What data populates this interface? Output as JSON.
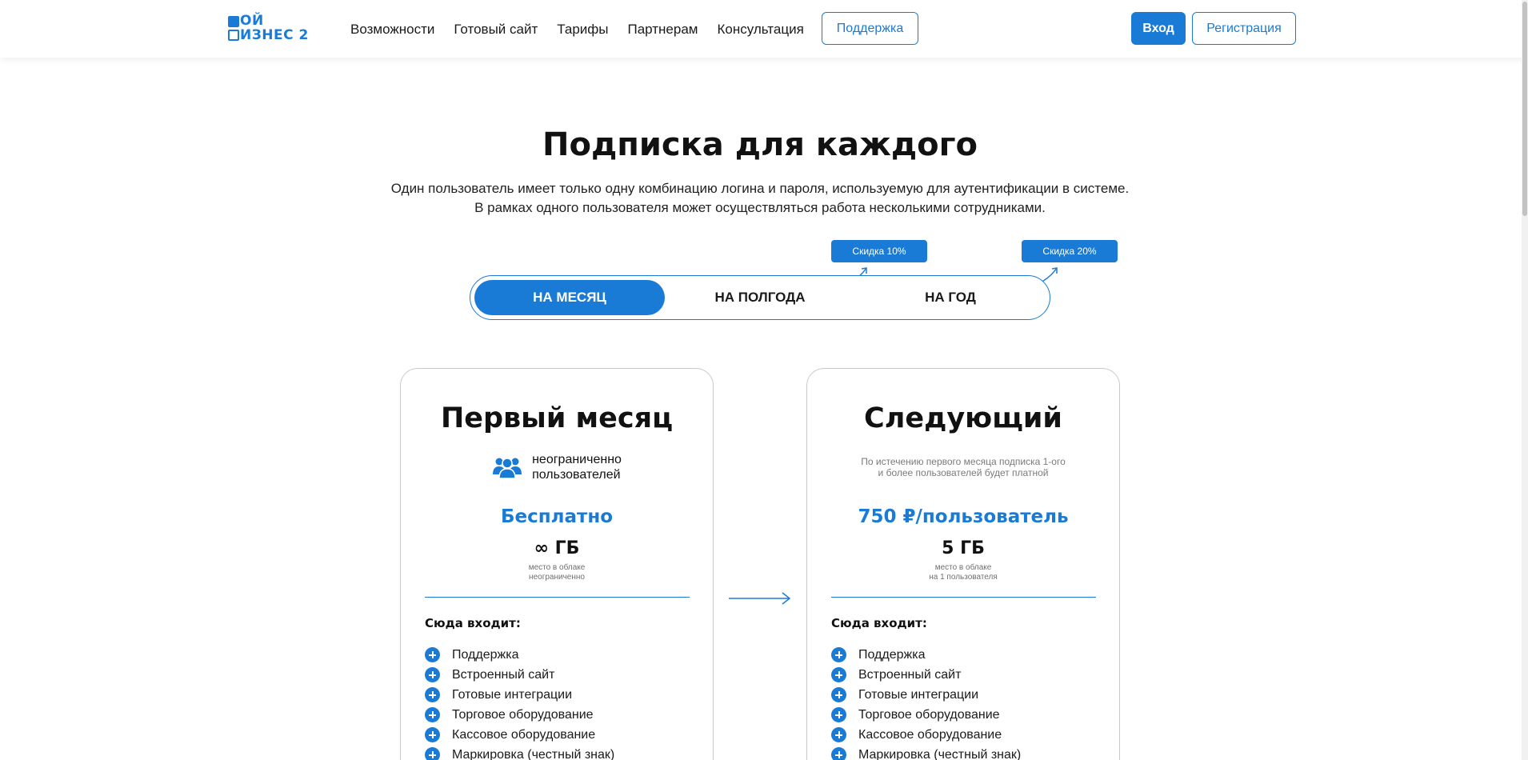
{
  "logo": {
    "line1": "ОЙ",
    "line2": "ИЗНЕС 2"
  },
  "nav": {
    "items": [
      "Возможности",
      "Готовый сайт",
      "Тарифы",
      "Партнерам",
      "Консультация"
    ],
    "support": "Поддержка",
    "login": "Вход",
    "register": "Регистрация"
  },
  "hero": {
    "title": "Подписка для каждого",
    "line1": "Один пользователь имеет только одну комбинацию логина и пароля, используемую для аутентификации в системе.",
    "line2": "В рамках одного пользователя может осуществляться работа несколькими сотрудниками."
  },
  "discounts": {
    "half_year": "Скидка 10%",
    "year": "Скидка 20%"
  },
  "period_toggle": {
    "options": [
      "НА МЕСЯЦ",
      "НА ПОЛГОДА",
      "НА ГОД"
    ],
    "selected": "НА МЕСЯЦ"
  },
  "cards": [
    {
      "title": "Первый месяц",
      "users_line1": "неограниченно",
      "users_line2": "пользователей",
      "price": "Бесплатно",
      "storage": "∞ ГБ",
      "storage_note1": "место в облаке",
      "storage_note2": "неограниченно",
      "includes": "Сюда входит:",
      "features": [
        "Поддержка",
        "Встроенный сайт",
        "Готовые интеграции",
        "Торговое оборудование",
        "Кассовое оборудование",
        "Маркировка (честный знак)"
      ]
    },
    {
      "title": "Следующий",
      "note1": "По истечению первого месяца подписка 1-ого",
      "note2": "и более пользователей будет платной",
      "price": "750 ₽/пользователь",
      "storage": "5 ГБ",
      "storage_note1": "место в облаке",
      "storage_note2": "на 1 пользователя",
      "includes": "Сюда входит:",
      "features": [
        "Поддержка",
        "Встроенный сайт",
        "Готовые интеграции",
        "Торговое оборудование",
        "Кассовое оборудование",
        "Маркировка (честный знак)"
      ]
    }
  ],
  "colors": {
    "accent": "#1a7bd6",
    "text": "#111111",
    "card_border": "#c9c9c9"
  }
}
